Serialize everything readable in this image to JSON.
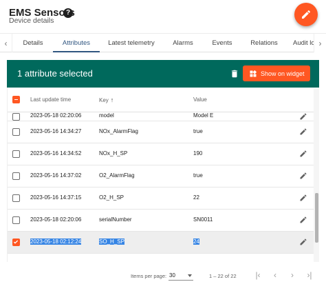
{
  "header": {
    "title": "EMS Sensors",
    "subtitle": "Device details",
    "help_icon": "help-circle-icon",
    "edit_fab_icon": "pencil-icon"
  },
  "tabs": [
    {
      "label": "Details",
      "active": false
    },
    {
      "label": "Attributes",
      "active": true
    },
    {
      "label": "Latest telemetry",
      "active": false
    },
    {
      "label": "Alarms",
      "active": false
    },
    {
      "label": "Events",
      "active": false
    },
    {
      "label": "Relations",
      "active": false
    },
    {
      "label": "Audit lo",
      "active": false
    }
  ],
  "selection": {
    "text": "1 attribute selected",
    "show_widget_label": "Show on widget"
  },
  "table": {
    "columns": {
      "time": "Last update time",
      "key": "Key",
      "value": "Value",
      "key_sort": "↑"
    },
    "rows": [
      {
        "time": "2023-05-18 02:20:06",
        "key": "model",
        "value": "Model E",
        "selected": false
      },
      {
        "time": "2023-05-16 14:34:27",
        "key": "NOx_AlarmFlag",
        "value": "true",
        "selected": false
      },
      {
        "time": "2023-05-16 14:34:52",
        "key": "NOx_H_SP",
        "value": "190",
        "selected": false
      },
      {
        "time": "2023-05-16 14:37:02",
        "key": "O2_AlarmFlag",
        "value": "true",
        "selected": false
      },
      {
        "time": "2023-05-16 14:37:15",
        "key": "O2_H_SP",
        "value": "22",
        "selected": false
      },
      {
        "time": "2023-05-18 02:20:06",
        "key": "serialNumber",
        "value": "SN0011",
        "selected": false
      },
      {
        "time": "2023-05-18 02:12:24",
        "key": "SO_H_SP",
        "value": "24",
        "selected": true
      }
    ]
  },
  "paginator": {
    "items_per_page_label": "Items per page:",
    "page_size": "30",
    "range": "1 – 22 of 22"
  },
  "colors": {
    "accent": "#ff5722",
    "selection_bar": "#00695c",
    "tab_active": "#305680"
  }
}
